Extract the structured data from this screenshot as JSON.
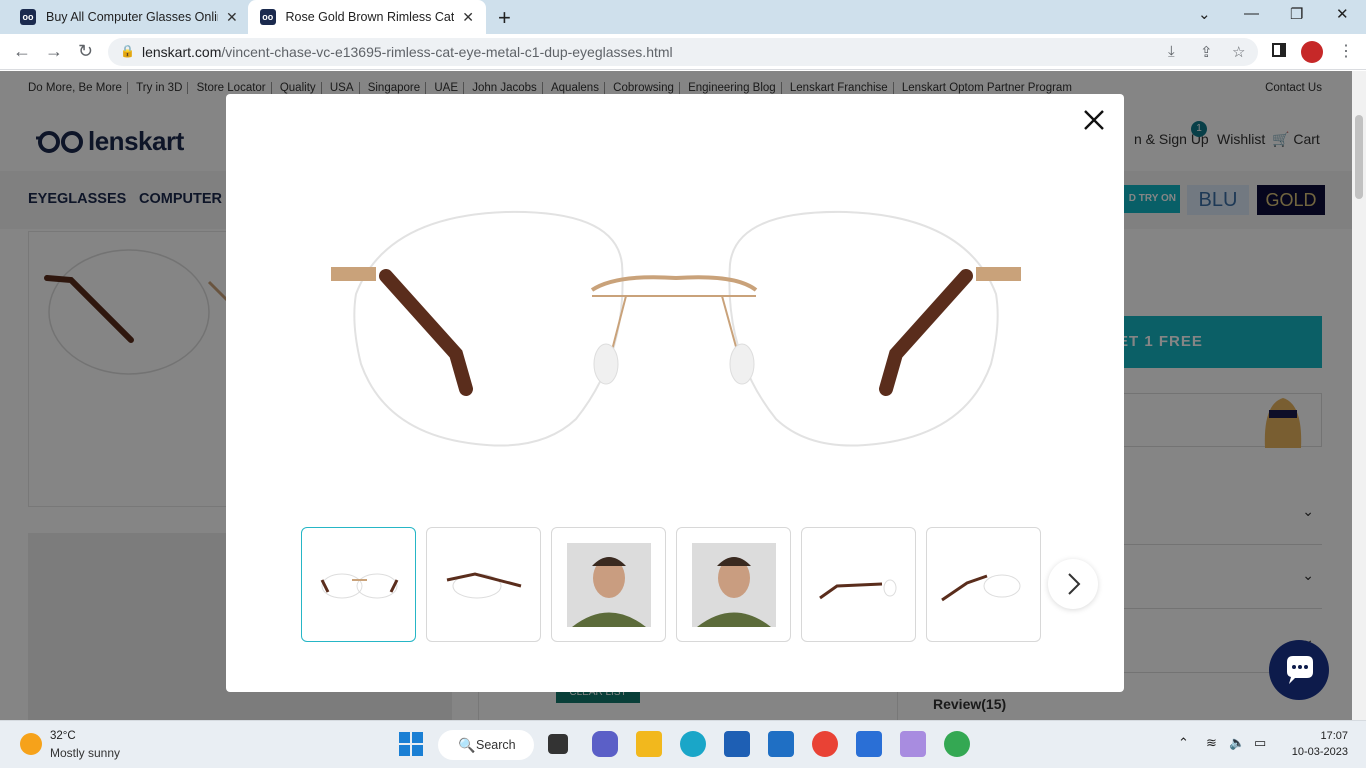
{
  "browser": {
    "tabs": [
      {
        "title": "Buy All Computer Glasses Online",
        "active": false
      },
      {
        "title": "Rose Gold Brown Rimless Cat Eye",
        "active": true
      }
    ],
    "url_host": "lenskart.com",
    "url_path": "/vincent-chase-vc-e13695-rimless-cat-eye-metal-c1-dup-eyeglasses.html"
  },
  "site": {
    "top_links": [
      "Do More, Be More",
      "Try in 3D",
      "Store Locator",
      "Quality",
      "USA",
      "Singapore",
      "UAE",
      "John Jacobs",
      "Aqualens",
      "Cobrowsing",
      "Engineering Blog",
      "Lenskart Franchise",
      "Lenskart Optom Partner Program"
    ],
    "contact": "Contact Us",
    "logo": "lenskart",
    "signin": "n & Sign Up",
    "wishlist": "Wishlist",
    "wishlist_count": "1",
    "cart": "Cart",
    "menu": [
      "EYEGLASSES",
      "COMPUTER"
    ],
    "tryon": "D TRY ON",
    "blu": "BLU",
    "gold": "GOLD",
    "buy_free": "ET 1 FREE",
    "review": "Review(15)",
    "clear_list": "CLEAR LIST"
  },
  "modal": {
    "thumbnails": [
      "front-view",
      "angle-view",
      "model-front",
      "model-side",
      "side-view",
      "angled-side-view"
    ],
    "selected_index": 0
  },
  "taskbar": {
    "temperature": "32°C",
    "weather": "Mostly sunny",
    "search": "Search",
    "time": "17:07",
    "date": "10-03-2023"
  },
  "colors": {
    "brand_navy": "#1b2a4e",
    "accent_teal": "#16b7c3",
    "frame_gold": "#c9a27a",
    "temple_brown": "#5a2d1c"
  }
}
